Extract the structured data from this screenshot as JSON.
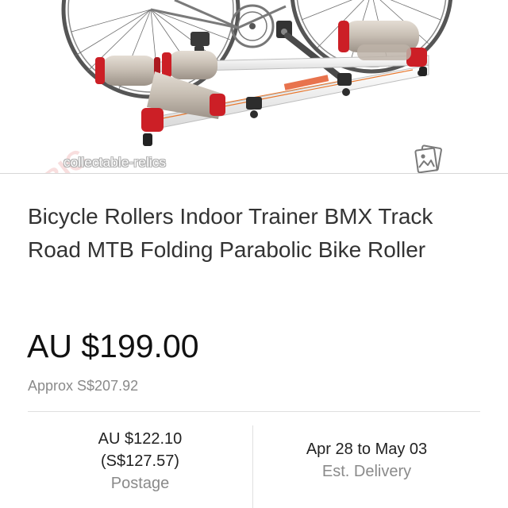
{
  "listing": {
    "watermark": "collectable-relics",
    "title": "Bicycle Rollers Indoor Trainer BMX Track Road MTB Folding Parabolic Bike Roller",
    "price": "AU $199.00",
    "approx_price": "Approx S$207.92",
    "postage": {
      "amount": "AU $122.10",
      "converted": "(S$127.57)",
      "caption": "Postage"
    },
    "delivery": {
      "dates": "Apr 28 to May 03",
      "caption": "Est. Delivery"
    }
  },
  "icons": {
    "gallery": "photo-gallery-icon"
  },
  "colors": {
    "roller_caps": "#cc1f26",
    "frame": "#f2f2f2",
    "text_primary": "#333333",
    "text_secondary": "#8a8a8a"
  }
}
